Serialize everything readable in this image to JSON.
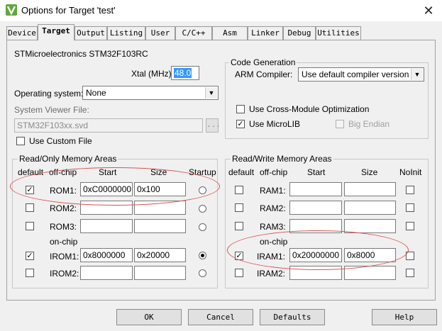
{
  "window": {
    "title": "Options for Target 'test'",
    "close_glyph": "✕",
    "icon": "vision-app-icon"
  },
  "tabs": [
    {
      "label": "Device"
    },
    {
      "label": "Target"
    },
    {
      "label": "Output"
    },
    {
      "label": "Listing"
    },
    {
      "label": "User"
    },
    {
      "label": "C/C++"
    },
    {
      "label": "Asm"
    },
    {
      "label": "Linker"
    },
    {
      "label": "Debug"
    },
    {
      "label": "Utilities"
    }
  ],
  "active_tab": "Target",
  "device": {
    "name": "STMicroelectronics STM32F103RC"
  },
  "xtal": {
    "label": "Xtal (MHz):",
    "value": "48.0"
  },
  "os": {
    "label": "Operating system:",
    "value": "None"
  },
  "svd": {
    "label": "System Viewer File:",
    "value": "STM32F103xx.svd",
    "browse_label": "..."
  },
  "custom_file": {
    "label": "Use Custom File",
    "checked": false
  },
  "code_gen": {
    "title": "Code Generation",
    "compiler_label": "ARM Compiler:",
    "compiler_value": "Use default compiler version",
    "cross_module": {
      "label": "Use Cross-Module Optimization",
      "checked": false
    },
    "microlib": {
      "label": "Use MicroLIB",
      "checked": true
    },
    "big_endian": {
      "label": "Big Endian",
      "checked": false,
      "disabled": true
    }
  },
  "rom": {
    "title": "Read/Only Memory Areas",
    "headers": {
      "default": "default",
      "offchip": "off-chip",
      "start": "Start",
      "size": "Size",
      "startup": "Startup"
    },
    "onchip_label": "on-chip",
    "rows": [
      {
        "name": "ROM1:",
        "default": true,
        "start": "0xC0000000",
        "size": "0x100",
        "startup": false
      },
      {
        "name": "ROM2:",
        "default": false,
        "start": "",
        "size": "",
        "startup": false
      },
      {
        "name": "ROM3:",
        "default": false,
        "start": "",
        "size": "",
        "startup": false
      },
      {
        "name": "IROM1:",
        "default": true,
        "start": "0x8000000",
        "size": "0x20000",
        "startup": true
      },
      {
        "name": "IROM2:",
        "default": false,
        "start": "",
        "size": "",
        "startup": false
      }
    ]
  },
  "ram": {
    "title": "Read/Write Memory Areas",
    "headers": {
      "default": "default",
      "offchip": "off-chip",
      "start": "Start",
      "size": "Size",
      "noinit": "NoInit"
    },
    "onchip_label": "on-chip",
    "rows": [
      {
        "name": "RAM1:",
        "default": false,
        "start": "",
        "size": "",
        "noinit": false
      },
      {
        "name": "RAM2:",
        "default": false,
        "start": "",
        "size": "",
        "noinit": false
      },
      {
        "name": "RAM3:",
        "default": false,
        "start": "",
        "size": "",
        "noinit": false
      },
      {
        "name": "IRAM1:",
        "default": true,
        "start": "0x20000000",
        "size": "0x8000",
        "noinit": false
      },
      {
        "name": "IRAM2:",
        "default": false,
        "start": "",
        "size": "",
        "noinit": false
      }
    ]
  },
  "buttons": {
    "ok": "OK",
    "cancel": "Cancel",
    "defaults": "Defaults",
    "help": "Help"
  },
  "colors": {
    "annotation": "#d9534f",
    "selection": "#3399ff",
    "icon": "#5fa83a"
  },
  "check_glyph": "✓"
}
